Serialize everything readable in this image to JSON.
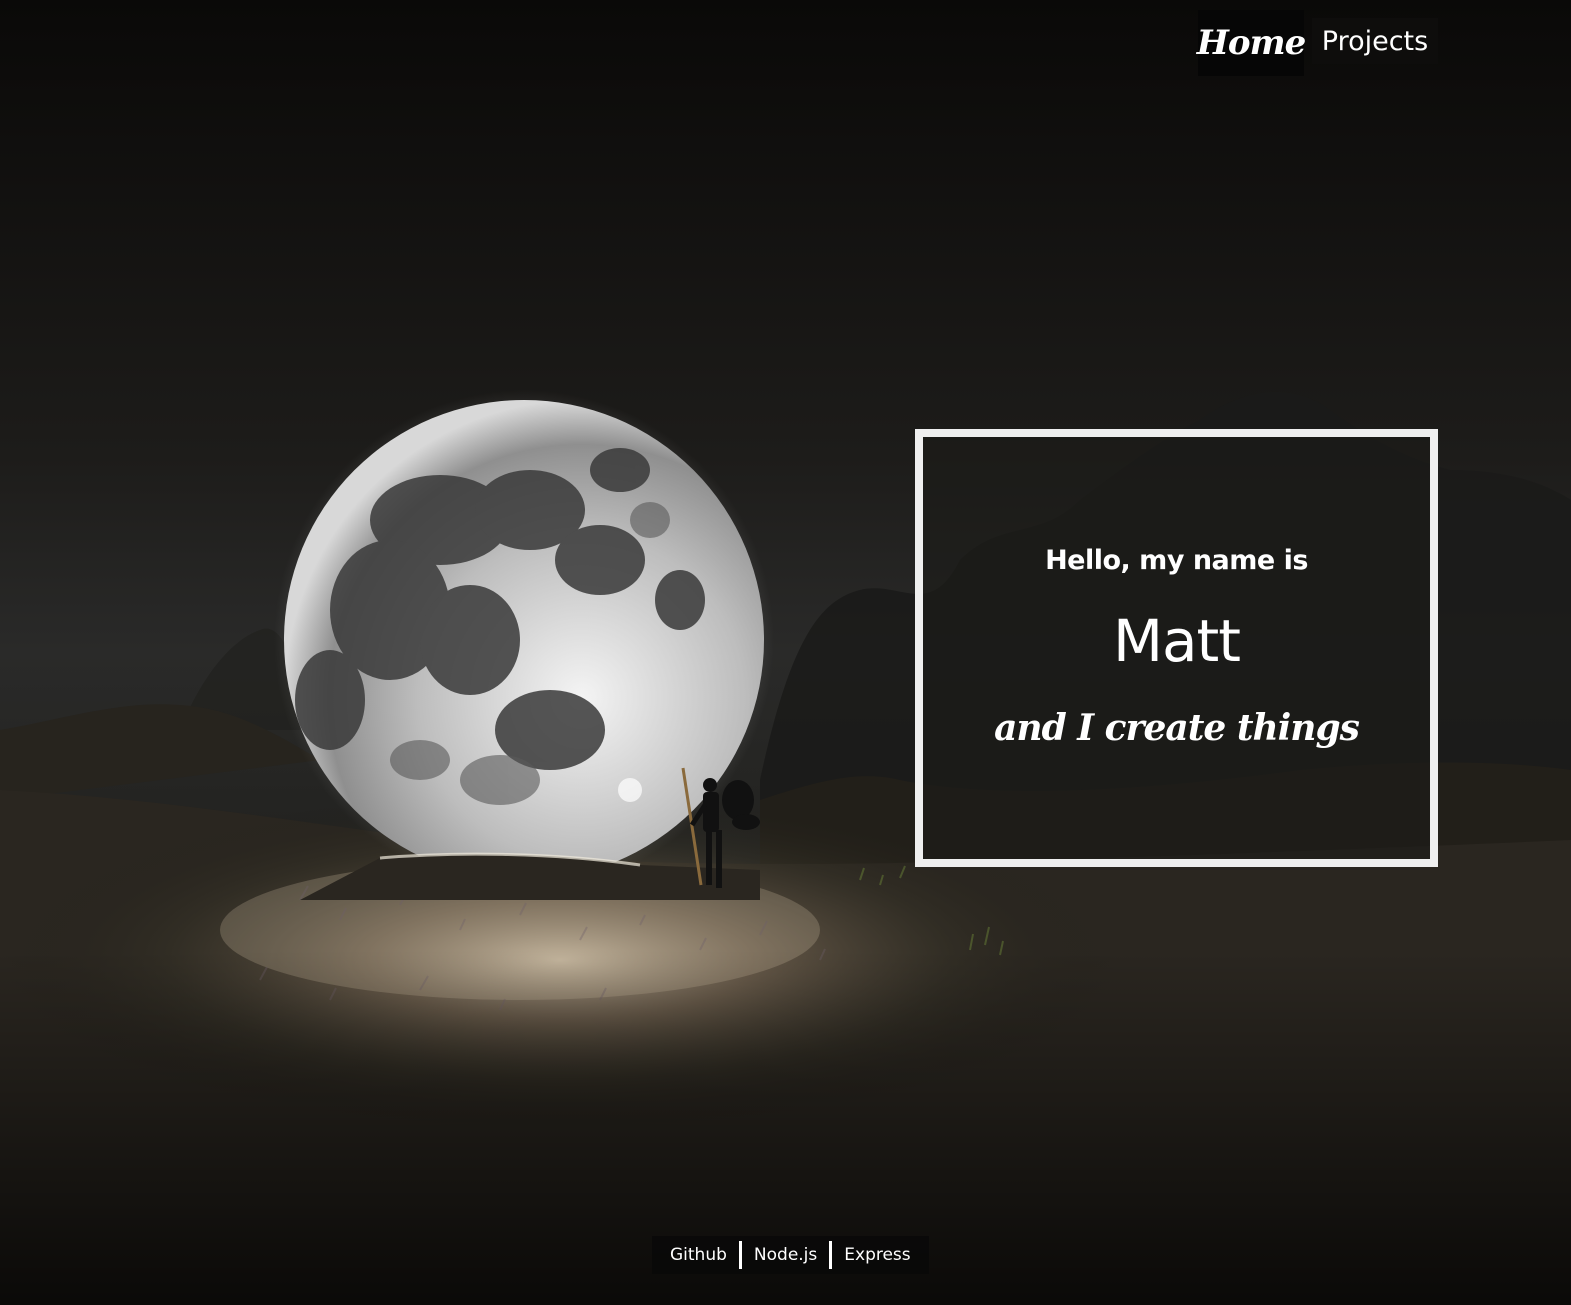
{
  "nav": {
    "home_label": "Home",
    "projects_label": "Projects"
  },
  "intro": {
    "greeting": "Hello, my name is",
    "name": "Matt",
    "tagline": "and I create things"
  },
  "footer": {
    "links": [
      {
        "label": "Github"
      },
      {
        "label": "Node.js"
      },
      {
        "label": "Express"
      }
    ]
  },
  "colors": {
    "background": "#0b0a09",
    "box_border": "#efefef",
    "text": "#ffffff"
  }
}
